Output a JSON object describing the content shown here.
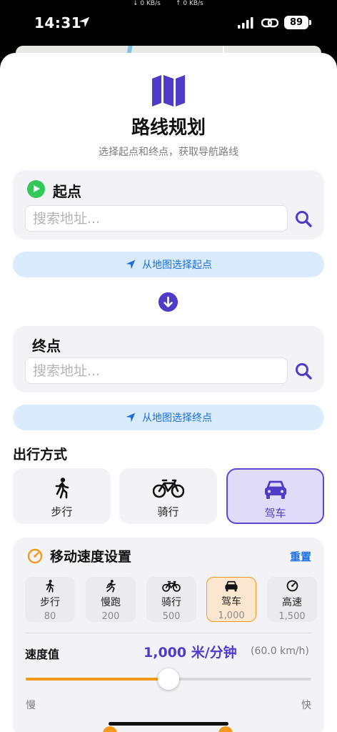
{
  "status_bar": {
    "time": "14:31",
    "net_down": "↓ 0 KB/s",
    "net_up": "↑ 0 KB/s",
    "battery": "89"
  },
  "header": {
    "title": "路线规划",
    "subtitle": "选择起点和终点，获取导航路线",
    "icon": "map-icon",
    "icon_color": "#4e3cc9"
  },
  "start": {
    "label": "起点",
    "placeholder": "搜索地址...",
    "map_button": "从地图选择起点"
  },
  "end": {
    "label": "终点",
    "placeholder": "搜索地址...",
    "map_button": "从地图选择终点"
  },
  "travel_mode": {
    "title": "出行方式",
    "options": [
      {
        "label": "步行",
        "icon": "walk-icon"
      },
      {
        "label": "骑行",
        "icon": "bike-icon"
      },
      {
        "label": "驾车",
        "icon": "car-icon",
        "selected": true
      }
    ]
  },
  "speed_settings": {
    "title": "移动速度设置",
    "reset": "重置",
    "presets": [
      {
        "label": "步行",
        "value": "80",
        "icon": "walk-icon"
      },
      {
        "label": "慢跑",
        "value": "200",
        "icon": "run-icon"
      },
      {
        "label": "骑行",
        "value": "500",
        "icon": "bike-icon"
      },
      {
        "label": "驾车",
        "value": "1,000",
        "icon": "car-icon",
        "selected": true
      },
      {
        "label": "高速",
        "value": "1,500",
        "icon": "speedometer-icon"
      }
    ],
    "speed_label": "速度值",
    "speed_value": "1,000 米/分钟",
    "speed_kmh": "(60.0 km/h)",
    "slider_fraction": 0.5,
    "slow": "慢",
    "fast": "快"
  },
  "colors": {
    "accent": "#4e3cc9",
    "link": "#1b6fe0",
    "orange": "#f39a1e",
    "green": "#34c759"
  }
}
